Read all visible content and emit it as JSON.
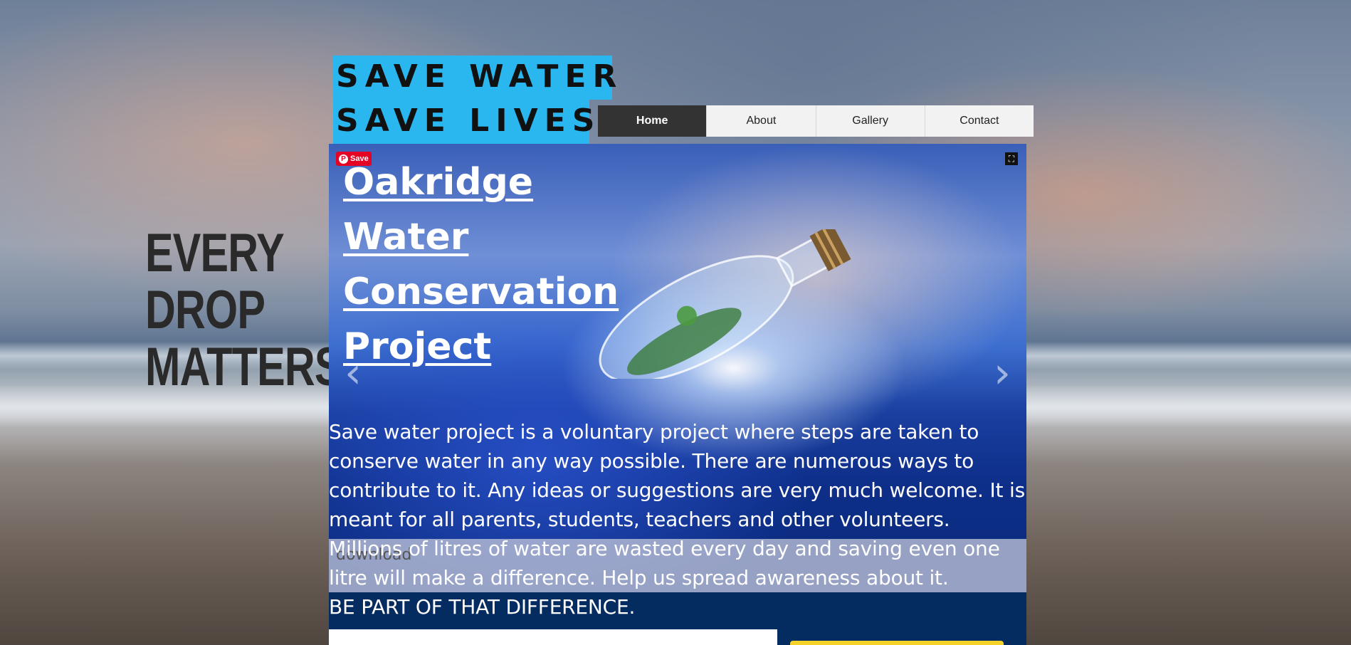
{
  "header": {
    "title_line1": "SAVE WATER",
    "title_line2": "SAVE LIVES"
  },
  "nav": {
    "items": [
      {
        "label": "Home",
        "active": true
      },
      {
        "label": "About",
        "active": false
      },
      {
        "label": "Gallery",
        "active": false
      },
      {
        "label": "Contact",
        "active": false
      }
    ]
  },
  "tagline": {
    "line1": "EVERY",
    "line2": "DROP",
    "line3": "MATTERS"
  },
  "slideshow": {
    "pin_button_label": "Save",
    "title_lines": [
      "Oakridge",
      "Water",
      "Conservation",
      "Project"
    ],
    "caption": "download",
    "prev_arrow": "‹",
    "next_arrow": "›",
    "fullscreen_icon": "⛶"
  },
  "description": {
    "body": "Save water project is a voluntary project where steps are taken to conserve water in any way possible. There are numerous ways to contribute to it. Any ideas or suggestions are very much welcome. It is meant for all parents, students, teachers and other volunteers. Millions of litres of water are wasted every day and saving even one litre will make a difference. Help us spread awareness about it.",
    "closing": "BE PART OF THAT DIFFERENCE."
  },
  "colors": {
    "title_bg": "#2ab6ee",
    "nav_active_bg": "#333333",
    "bottom_band": "#052c60",
    "pinterest_red": "#e60023"
  }
}
